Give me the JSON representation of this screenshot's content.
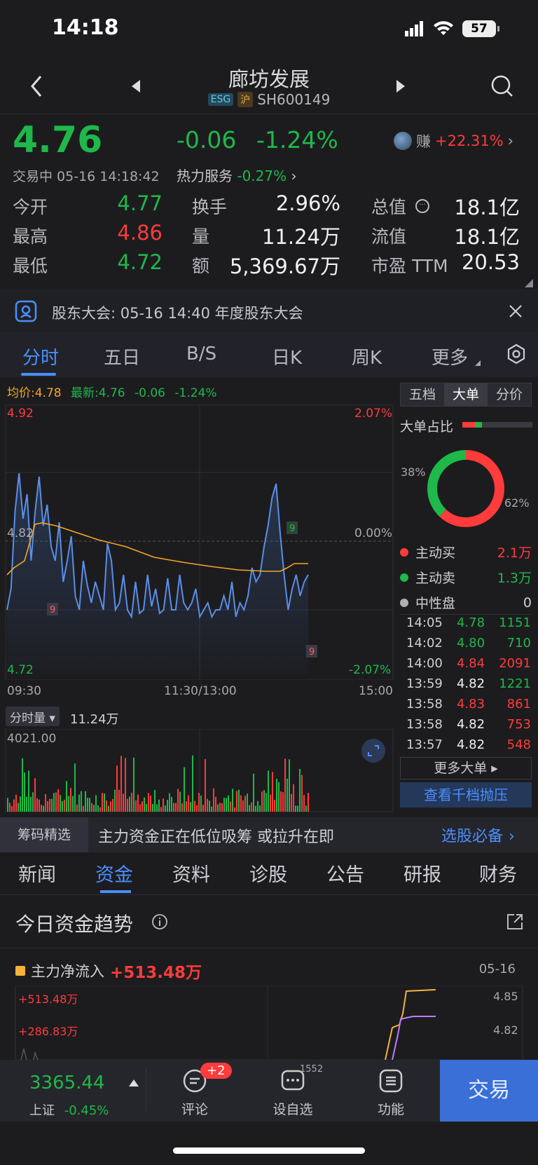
{
  "status_bar": {
    "time": "14:18",
    "battery": "57"
  },
  "header": {
    "stock_name": "廊坊发展",
    "tag_esg": "ESG",
    "tag_market": "沪",
    "stock_code": "SH600149"
  },
  "quote": {
    "price": "4.76",
    "change": "-0.06",
    "change_pct": "-1.24%",
    "earn_label": "赚",
    "earn_pct": "+22.31%",
    "trade_status": "交易中 05-16 14:18:42",
    "hot_label": "热力服务",
    "hot_pct": "-0.27%"
  },
  "stats": [
    {
      "label": "今开",
      "value": "4.77",
      "color": "green"
    },
    {
      "label": "最高",
      "value": "4.86",
      "color": "red"
    },
    {
      "label": "最低",
      "value": "4.72",
      "color": "green"
    },
    {
      "label": "换手",
      "value": "2.96%",
      "color": "white"
    },
    {
      "label": "量",
      "value": "11.24万",
      "color": "white"
    },
    {
      "label": "额",
      "value": "5,369.67万",
      "color": "white"
    },
    {
      "label": "总值",
      "value": "18.1亿",
      "color": "white"
    },
    {
      "label": "流值",
      "value": "18.1亿",
      "color": "white"
    },
    {
      "label": "市盈 TTM",
      "value": "20.53",
      "color": "white"
    }
  ],
  "notice": {
    "text": "股东大会: 05-16 14:40 年度股东大会"
  },
  "chart_tabs": [
    "分时",
    "五日",
    "B/S",
    "日K",
    "周K",
    "更多"
  ],
  "intraday": {
    "avg_label": "均价:4.78",
    "latest_label": "最新:4.76",
    "latest_change": "-0.06",
    "latest_pct": "-1.24%",
    "price_high": "4.92",
    "price_mid": "4.82",
    "price_low": "4.72",
    "pct_high": "2.07%",
    "pct_mid": "0.00%",
    "pct_low": "-2.07%",
    "time_start": "09:30",
    "time_mid": "11:30/13:00",
    "time_end": "15:00",
    "marker_9": "9",
    "vol_selector": "分时量",
    "vol_total": "11.24万",
    "vol_max": "4021.00"
  },
  "side_panel": {
    "tabs": [
      "五档",
      "大单",
      "分价"
    ],
    "big_order_ratio_label": "大单占比",
    "buy_pct": "38%",
    "sell_pct": "62%",
    "active_buy_label": "主动买",
    "active_buy_value": "2.1万",
    "active_sell_label": "主动卖",
    "active_sell_value": "1.3万",
    "neutral_label": "中性盘",
    "neutral_value": "0",
    "trades": [
      {
        "time": "14:05",
        "price": "4.78",
        "vol": "1151",
        "pc": "green",
        "vc": "green"
      },
      {
        "time": "14:02",
        "price": "4.80",
        "vol": "710",
        "pc": "green",
        "vc": "green"
      },
      {
        "time": "14:00",
        "price": "4.84",
        "vol": "2091",
        "pc": "red",
        "vc": "red"
      },
      {
        "time": "13:59",
        "price": "4.82",
        "vol": "1221",
        "pc": "white",
        "vc": "green"
      },
      {
        "time": "13:58",
        "price": "4.83",
        "vol": "861",
        "pc": "red",
        "vc": "red"
      },
      {
        "time": "13:58",
        "price": "4.82",
        "vol": "753",
        "pc": "white",
        "vc": "red"
      },
      {
        "time": "13:57",
        "price": "4.82",
        "vol": "548",
        "pc": "white",
        "vc": "red"
      }
    ],
    "more_big": "更多大单 ▸",
    "qianxia": "查看千档抛压"
  },
  "chips": {
    "label": "筹码精选",
    "text": "主力资金正在低位吸筹 或拉升在即",
    "link": "选股必备"
  },
  "lower_tabs": [
    "新闻",
    "资金",
    "资料",
    "诊股",
    "公告",
    "研报",
    "财务"
  ],
  "fund": {
    "title": "今日资金趋势",
    "legend_label": "主力净流入",
    "legend_value": "+513.48万",
    "date": "05-16",
    "y_left_1": "+513.48万",
    "y_left_2": "+286.83万",
    "y_right_1": "4.85",
    "y_right_2": "4.82"
  },
  "bottom_nav": {
    "index_value": "3365.44",
    "index_name": "上证",
    "index_pct": "-0.45%",
    "comment_label": "评论",
    "comment_badge": "+2",
    "watch_label": "设自选",
    "watch_count": "1552",
    "func_label": "功能",
    "trade_label": "交易"
  },
  "colors": {
    "up": "#ff3b3b",
    "down": "#1fb84a",
    "accent": "#4a8fff",
    "avg_line": "#f5a623",
    "price_line": "#5b8ee6"
  }
}
